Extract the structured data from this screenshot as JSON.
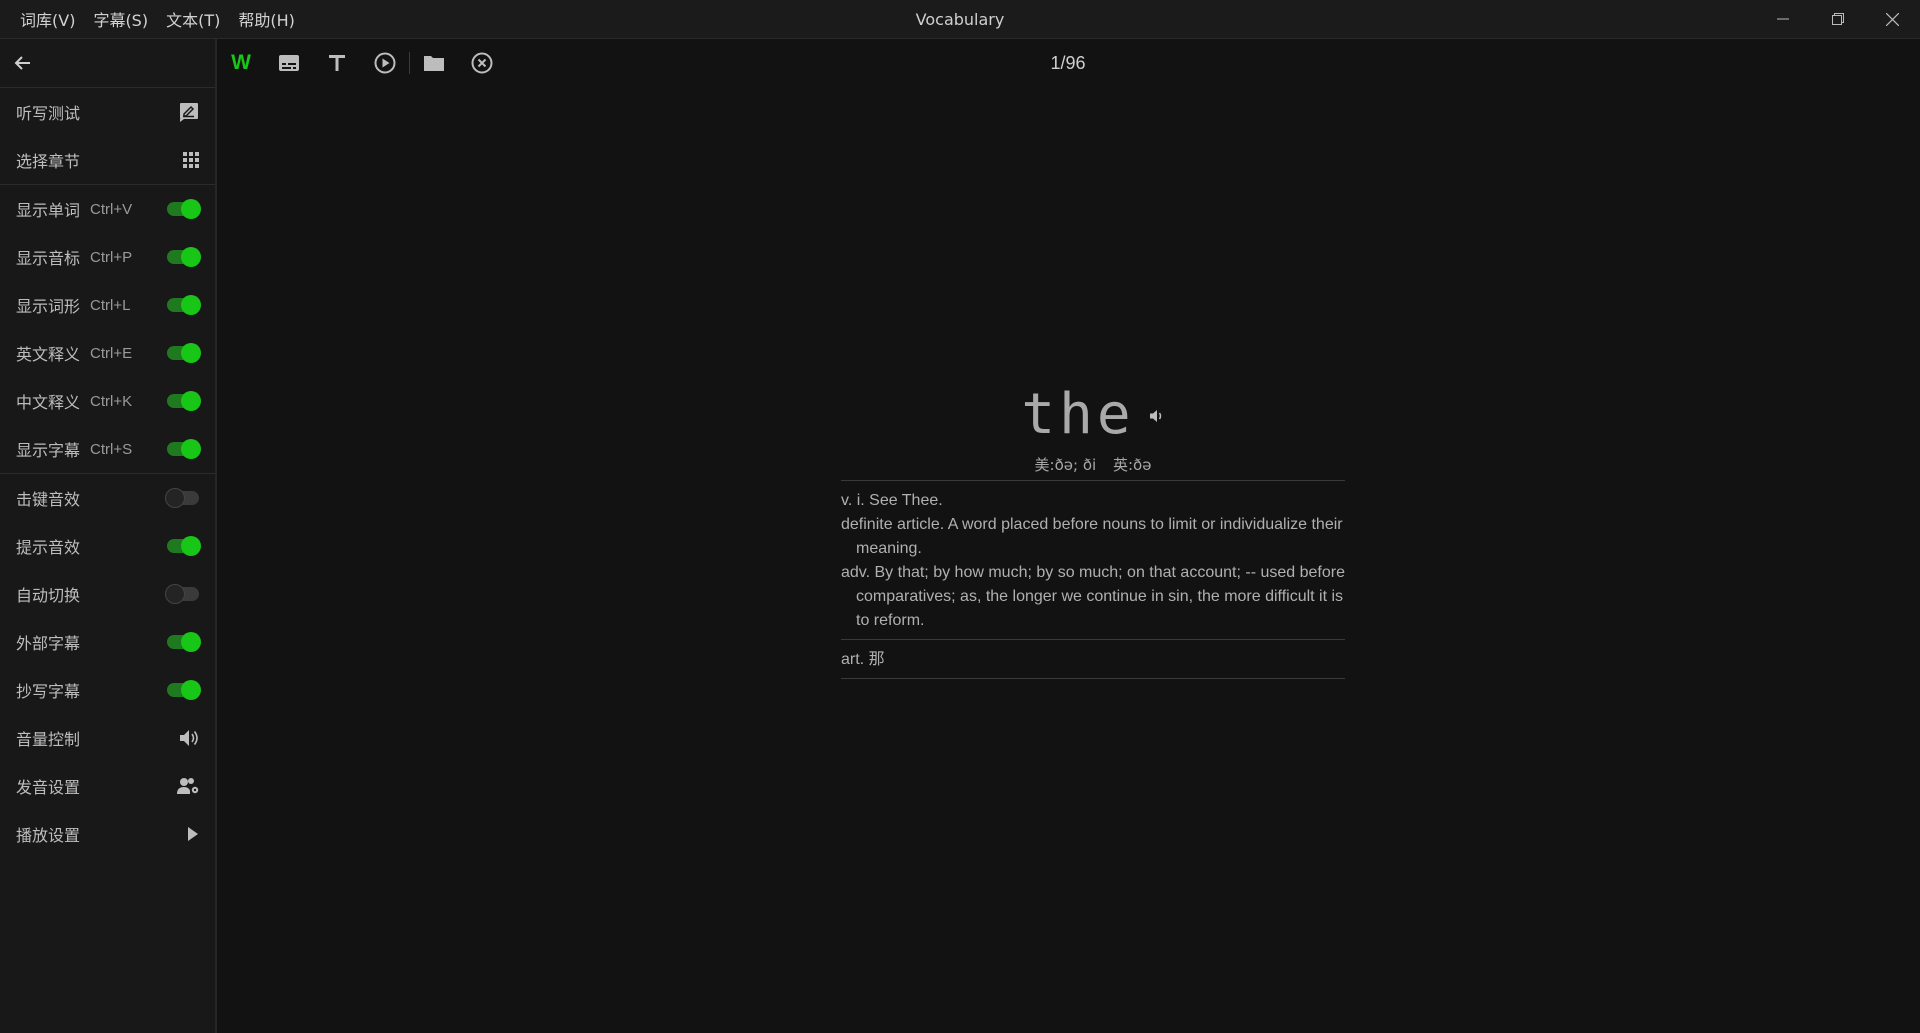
{
  "window": {
    "title": "Vocabulary",
    "menu": [
      "词库(V)",
      "字幕(S)",
      "文本(T)",
      "帮助(H)"
    ]
  },
  "sidebar": {
    "dictation": "听写测试",
    "select_chapter": "选择章节",
    "toggles": [
      {
        "label": "显示单词",
        "shortcut": "Ctrl+V",
        "on": true
      },
      {
        "label": "显示音标",
        "shortcut": "Ctrl+P",
        "on": true
      },
      {
        "label": "显示词形",
        "shortcut": "Ctrl+L",
        "on": true
      },
      {
        "label": "英文释义",
        "shortcut": "Ctrl+E",
        "on": true
      },
      {
        "label": "中文释义",
        "shortcut": "Ctrl+K",
        "on": true
      },
      {
        "label": "显示字幕",
        "shortcut": "Ctrl+S",
        "on": true
      }
    ],
    "settings": [
      {
        "label": "击键音效",
        "on": false
      },
      {
        "label": "提示音效",
        "on": true
      },
      {
        "label": "自动切换",
        "on": false
      },
      {
        "label": "外部字幕",
        "on": true
      },
      {
        "label": "抄写字幕",
        "on": true
      }
    ],
    "volume": "音量控制",
    "pronunciation": "发音设置",
    "playback": "播放设置"
  },
  "toolbar": {
    "word_mode": "W",
    "counter": "1/96"
  },
  "card": {
    "word": "the",
    "phonetic_us": "美:ðə; ði",
    "phonetic_uk": "英:ðə",
    "definitions": [
      "v. i. See Thee.",
      "definite article. A word placed before nouns to limit or individualize their meaning.",
      "adv. By that; by how much; by so much; on that account; -- used before comparatives; as, the longer we continue in sin, the more difficult it is to reform."
    ],
    "chinese": "art. 那"
  },
  "colors": {
    "accent": "#17c617",
    "background": "#121212",
    "sidebar": "#181818"
  }
}
